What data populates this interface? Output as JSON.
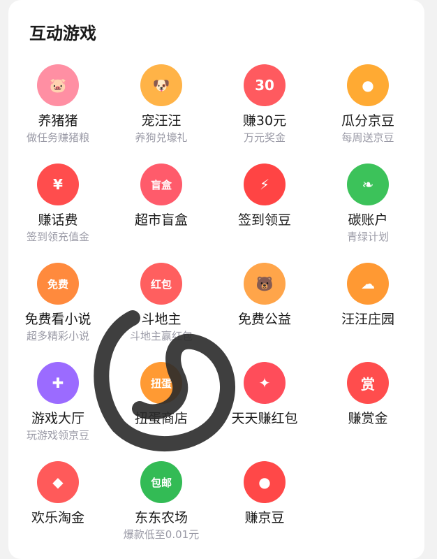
{
  "section": {
    "title": "互动游戏"
  },
  "games": [
    {
      "label": "养猪猪",
      "sub": "做任务赚猪粮",
      "icon": "pig-icon",
      "color": "#ff8fa3",
      "glyph": "🐷"
    },
    {
      "label": "宠汪汪",
      "sub": "养狗兑壕礼",
      "icon": "dog-icon",
      "color": "#ffb347",
      "glyph": "🐶"
    },
    {
      "label": "赚30元",
      "sub": "万元奖金",
      "icon": "calendar-30-icon",
      "color": "#ff5a5f",
      "glyph": "30"
    },
    {
      "label": "瓜分京豆",
      "sub": "每周送京豆",
      "icon": "beans-icon",
      "color": "#ffaa33",
      "glyph": "●"
    },
    {
      "label": "赚话费",
      "sub": "签到领充值金",
      "icon": "phone-bill-icon",
      "color": "#ff4d4d",
      "glyph": "¥"
    },
    {
      "label": "超市盲盒",
      "sub": "",
      "icon": "blind-box-icon",
      "color": "#ff5b6b",
      "glyph": "盲盒"
    },
    {
      "label": "签到领豆",
      "sub": "",
      "icon": "alarm-clock-icon",
      "color": "#ff4444",
      "glyph": "⚡"
    },
    {
      "label": "碳账户",
      "sub": "青绿计划",
      "icon": "leaf-icon",
      "color": "#3cc25a",
      "glyph": "❧"
    },
    {
      "label": "免费看小说",
      "sub": "超多精彩小说",
      "icon": "novel-book-icon",
      "color": "#ff8a3d",
      "glyph": "免费"
    },
    {
      "label": "斗地主",
      "sub": "斗地主赢红包",
      "icon": "cards-icon",
      "color": "#ff5f5f",
      "glyph": "红包"
    },
    {
      "label": "免费公益",
      "sub": "",
      "icon": "bear-icon",
      "color": "#ffa54a",
      "glyph": "🐻"
    },
    {
      "label": "汪汪庄园",
      "sub": "",
      "icon": "manor-icon",
      "color": "#ff9933",
      "glyph": "☁"
    },
    {
      "label": "游戏大厅",
      "sub": "玩游戏领京豆",
      "icon": "gamepad-icon",
      "color": "#9b6bff",
      "glyph": "✚"
    },
    {
      "label": "扭蛋商店",
      "sub": "",
      "icon": "capsule-icon",
      "color": "#ff9a33",
      "glyph": "扭蛋"
    },
    {
      "label": "天天赚红包",
      "sub": "",
      "icon": "spin-wheel-icon",
      "color": "#ff4d5a",
      "glyph": "✦"
    },
    {
      "label": "赚赏金",
      "sub": "",
      "icon": "reward-icon",
      "color": "#ff4d4d",
      "glyph": "赏"
    },
    {
      "label": "欢乐淘金",
      "sub": "",
      "icon": "money-bag-icon",
      "color": "#ff5a5a",
      "glyph": "◆"
    },
    {
      "label": "东东农场",
      "sub": "爆款低至0.01元",
      "icon": "tree-icon",
      "color": "#33bb55",
      "glyph": "包邮"
    },
    {
      "label": "赚京豆",
      "sub": "",
      "icon": "red-bag-icon",
      "color": "#ff4848",
      "glyph": "●"
    }
  ]
}
